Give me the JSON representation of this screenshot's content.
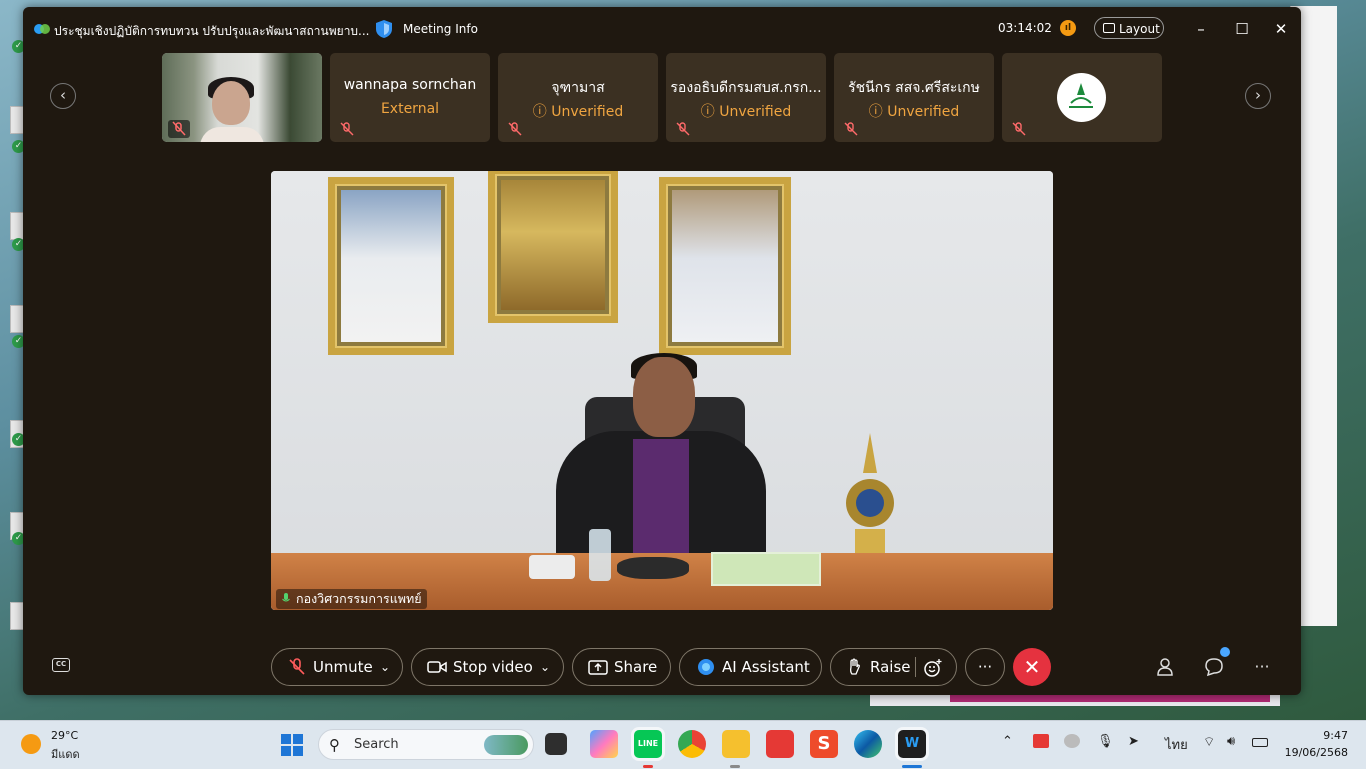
{
  "meeting": {
    "window_title": "ประชุมเชิงปฏิบัติการทบทวน ปรับปรุงและพัฒนาสถานพยาบ...",
    "info_label": "Meeting Info",
    "elapsed_time": "03:14:02",
    "layout_label": "Layout"
  },
  "participants": [
    {
      "name": "wannapa sornchan",
      "status": "External"
    },
    {
      "name": "จุฑามาส",
      "status": "Unverified"
    },
    {
      "name": "รองอธิบดีกรมสบส.กรก...",
      "status": "Unverified"
    },
    {
      "name": "รัชนีกร สสจ.ศรีสะเกษ",
      "status": "Unverified"
    }
  ],
  "main_video": {
    "speaker_label": "กองวิศวกรรมการแพทย์"
  },
  "controls": {
    "unmute": "Unmute",
    "stop_video": "Stop video",
    "share": "Share",
    "ai_assistant": "AI Assistant",
    "raise": "Raise"
  },
  "taskbar": {
    "weather_temp": "29°C",
    "weather_desc": "มีแดด",
    "search_label": "Search",
    "language": "ไทย",
    "time": "9:47",
    "date": "19/06/2568"
  },
  "colors": {
    "meeting_bg": "#1f1810",
    "tile_bg": "#3b3022",
    "status_orange": "#f0a541",
    "end_red": "#e5323f",
    "taskbar_bg": "#dde6ee"
  }
}
